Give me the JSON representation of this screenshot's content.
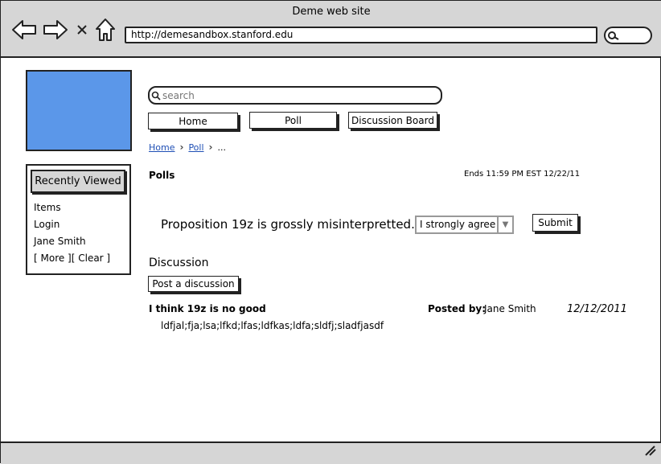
{
  "window": {
    "title": "Deme web site"
  },
  "browser": {
    "url": "http://demesandbox.stanford.edu",
    "icons": [
      "back-arrow-icon",
      "forward-arrow-icon",
      "close-x-icon",
      "home-icon",
      "search-icon",
      "resize-grip-icon"
    ]
  },
  "colors": {
    "logo_fill": "#5b97e9",
    "chrome_gray": "#d6d6d6",
    "link_blue": "#1f4fb5"
  },
  "search": {
    "placeholder": "search"
  },
  "nav": {
    "home": "Home",
    "poll": "Poll",
    "discussion_board": "Discussion Board"
  },
  "breadcrumb": {
    "home": "Home",
    "poll": "Poll",
    "ellipsis": "..."
  },
  "sidebar": {
    "header": "Recently Viewed",
    "items": [
      "Items",
      "Login",
      "Jane Smith"
    ],
    "more_clear": "[ More ][ Clear ]"
  },
  "poll": {
    "title": "Polls",
    "ends": "Ends 11:59 PM EST 12/22/11",
    "proposition": "Proposition 19z is grossly misinterpretted.",
    "selected_option": "I strongly agree",
    "submit_label": "Submit"
  },
  "discussion": {
    "title": "Discussion",
    "post_button": "Post a discussion",
    "posts": [
      {
        "title": "I think 19z is no good",
        "posted_by_label": "Posted by:",
        "author": "Jane Smith",
        "date": "12/12/2011",
        "body": "ldfjal;fja;lsa;lfkd;lfas;ldfkas;ldfa;sldfj;sladfjasdf"
      }
    ]
  }
}
